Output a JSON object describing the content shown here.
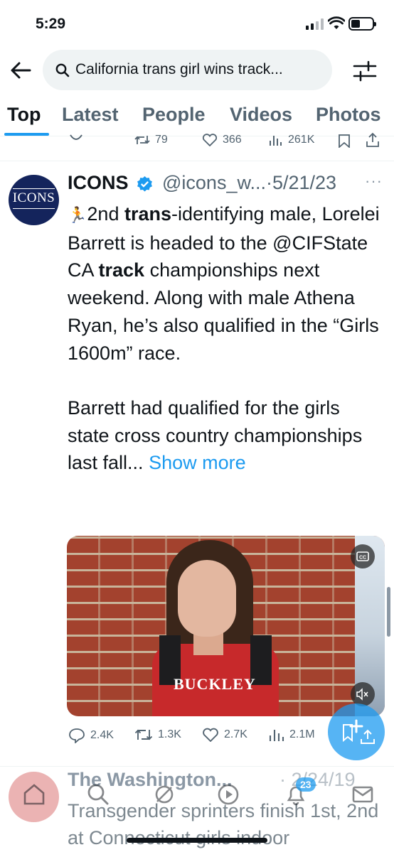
{
  "status_bar": {
    "time": "5:29",
    "battery_level": 0.3,
    "signal_bars": 2
  },
  "search": {
    "query": "California trans girl wins track..."
  },
  "tabs": [
    {
      "label": "Top",
      "active": true
    },
    {
      "label": "Latest",
      "active": false
    },
    {
      "label": "People",
      "active": false
    },
    {
      "label": "Videos",
      "active": false
    },
    {
      "label": "Photos",
      "active": false
    }
  ],
  "previous_tweet_actions": {
    "retweets": "79",
    "likes": "366",
    "views": "261K"
  },
  "tweet": {
    "avatar_text": "ICONS",
    "name": "ICONS",
    "handle": "@icons_w...",
    "separator": "·",
    "date": "5/21/23",
    "more": "···",
    "body": {
      "runner_emoji": "🏃",
      "p1_a": "2nd ",
      "p1_bold1": "trans",
      "p1_b": "-identifying male, Lorelei Barrett is headed to the @CIFState CA ",
      "p1_bold2": "track",
      "p1_c": " championships next weekend. Along with male Athena Ryan, he’s also qualified in the “Girls 1600m” race.",
      "p2": "Barrett had qualified for the girls state cross country championships last fall...",
      "show_more": "Show more"
    },
    "media": {
      "jersey_text": "BUCKLEY",
      "cc_label": "CC"
    },
    "actions": {
      "replies": "2.4K",
      "retweets": "1.3K",
      "likes": "2.7K",
      "views": "2.1M"
    }
  },
  "next_tweet": {
    "name": "The Washington...",
    "date": "· 2/24/19",
    "body": "Transgender sprinters finish 1st, 2nd at Connecticut girls indoor"
  },
  "bottom_nav": {
    "notifications_badge": "23"
  },
  "colors": {
    "accent": "#1d9bf0",
    "text": "#0f1419",
    "secondary": "#536471"
  }
}
